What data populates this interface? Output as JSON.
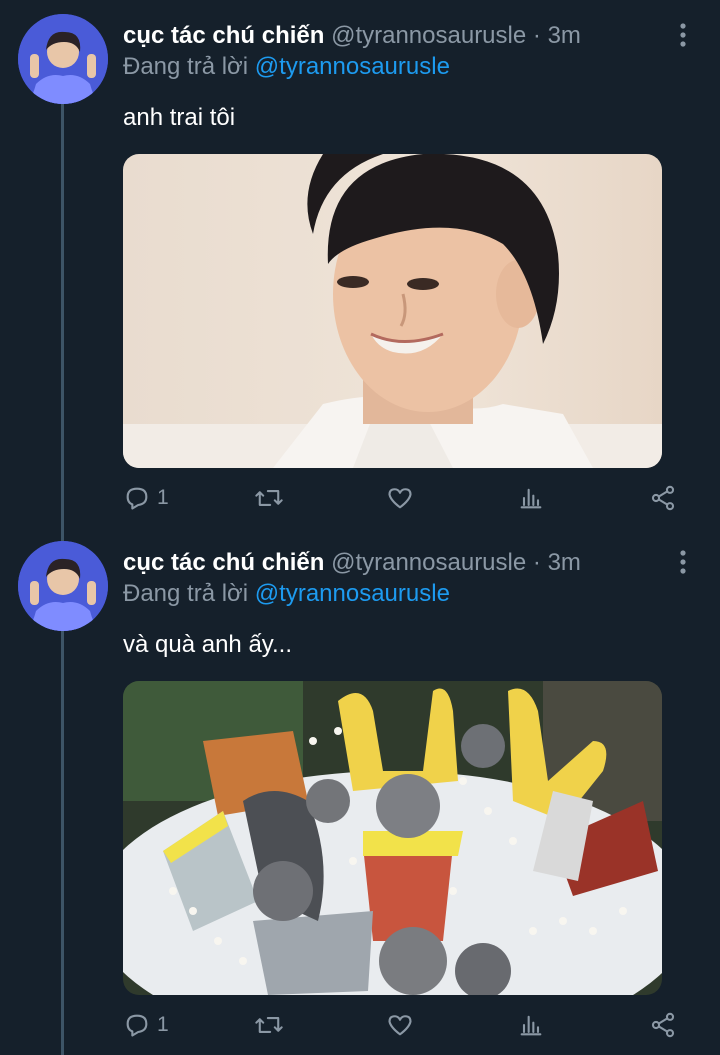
{
  "tweets": [
    {
      "author_name": "cục tác chú chiến",
      "handle": "@tyrannosaurusle",
      "separator": "·",
      "time": "3m",
      "replying_prefix": "Đang trả lời",
      "replying_to": "@tyrannosaurusle",
      "text": "anh trai tôi",
      "reply_count": "1"
    },
    {
      "author_name": "cục tác chú chiến",
      "handle": "@tyrannosaurusle",
      "separator": "·",
      "time": "3m",
      "replying_prefix": "Đang trả lời",
      "replying_to": "@tyrannosaurusle",
      "text": "và quà anh ấy...",
      "reply_count": "1"
    }
  ],
  "colors": {
    "background": "#15202b",
    "text_primary": "#ffffff",
    "text_secondary": "#8b98a5",
    "link": "#1d9bf0",
    "thread_line": "#3d5466"
  },
  "icons": [
    "more-vertical-icon",
    "reply-icon",
    "retweet-icon",
    "like-icon",
    "analytics-icon",
    "share-icon"
  ]
}
